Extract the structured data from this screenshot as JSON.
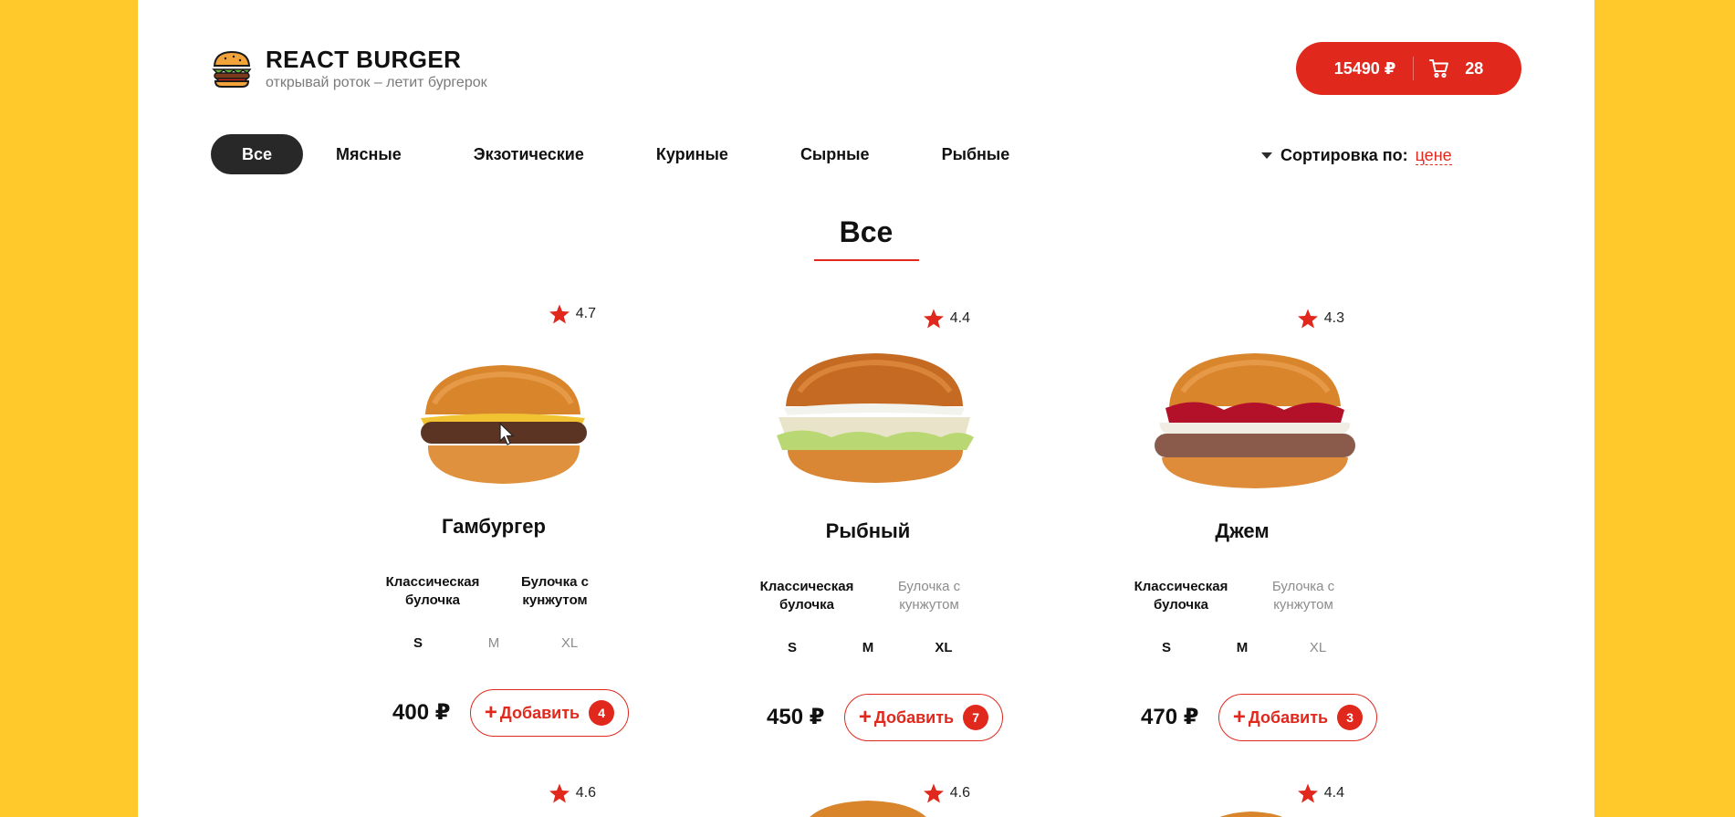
{
  "colors": {
    "accent": "#e0281d",
    "background": "#ffc82b",
    "dark": "#282828"
  },
  "header": {
    "title": "REACT BURGER",
    "subtitle": "открывай роток – летит бургерок",
    "logo_icon": "burger-icon",
    "cart": {
      "sum": "15490 ₽",
      "icon": "cart-icon",
      "count": "28"
    }
  },
  "categories": [
    "Все",
    "Мясные",
    "Экзотические",
    "Куриные",
    "Сырные",
    "Рыбные"
  ],
  "sort": {
    "label": "Сортировка по:",
    "value": "цене"
  },
  "section": {
    "title": "Все"
  },
  "products": [
    {
      "name": "Гамбургер",
      "rating": "4.7",
      "buns": [
        "Классическая булочка",
        "Булочка с кунжутом"
      ],
      "sizes": [
        "S",
        "M",
        "XL"
      ],
      "price": "400 ₽",
      "add_label": "Добавить",
      "count": "4"
    },
    {
      "name": "Рыбный",
      "rating": "4.4",
      "buns": [
        "Классическая булочка",
        "Булочка с кунжутом"
      ],
      "sizes": [
        "S",
        "M",
        "XL"
      ],
      "price": "450 ₽",
      "add_label": "Добавить",
      "count": "7"
    },
    {
      "name": "Джем",
      "rating": "4.3",
      "buns": [
        "Классическая булочка",
        "Булочка с кунжутом"
      ],
      "sizes": [
        "S",
        "M",
        "XL"
      ],
      "price": "470 ₽",
      "add_label": "Добавить",
      "count": "3"
    }
  ],
  "next_row_ratings": [
    "4.6",
    "4.6",
    "4.4"
  ]
}
